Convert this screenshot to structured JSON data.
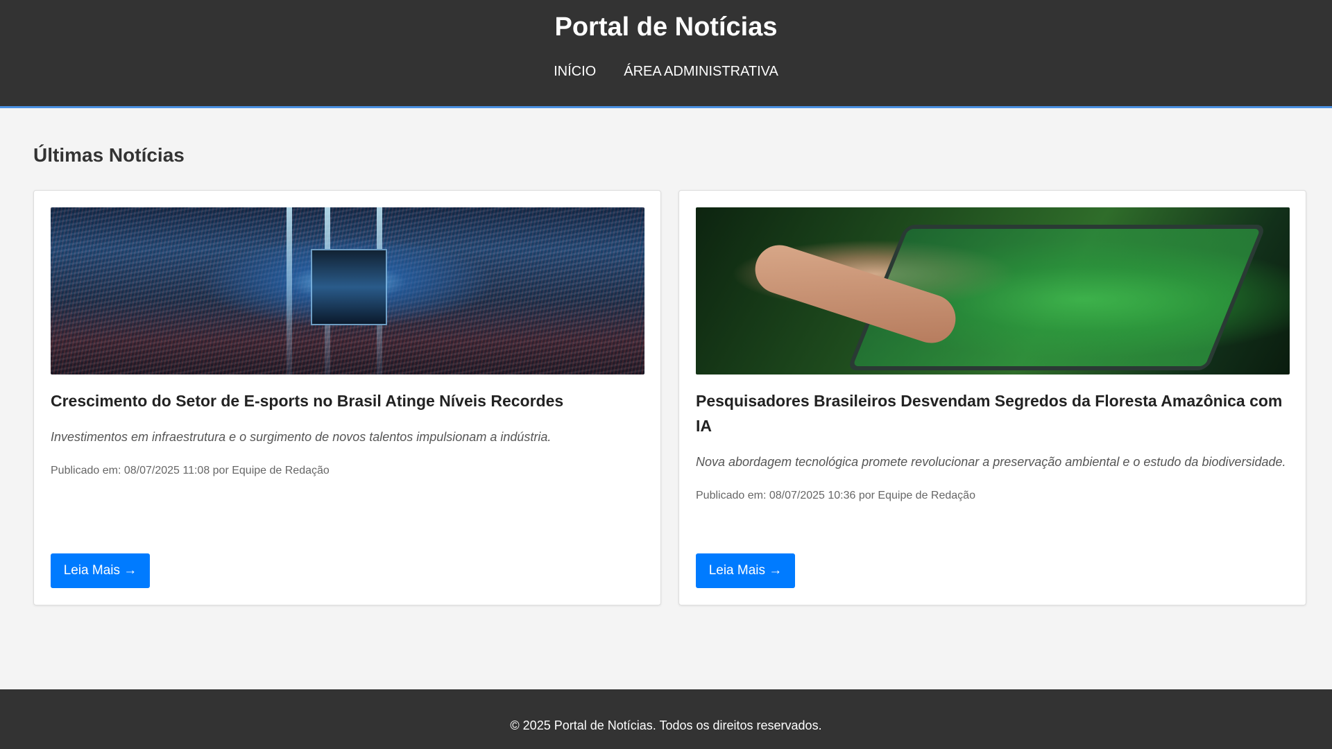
{
  "header": {
    "title": "Portal de Notícias",
    "nav": [
      {
        "label": "INÍCIO"
      },
      {
        "label": "ÁREA ADMINISTRATIVA"
      }
    ]
  },
  "main": {
    "section_title": "Últimas Notícias",
    "articles": [
      {
        "title": "Crescimento do Setor de E-sports no Brasil Atinge Níveis Recordes",
        "summary": "Investimentos em infraestrutura e o surgimento de novos talentos impulsionam a indústria.",
        "meta": "Publicado em: 08/07/2025 11:08 por Equipe de Redação",
        "button_label": "Leia Mais →"
      },
      {
        "title": "Pesquisadores Brasileiros Desvendam Segredos da Floresta Amazônica com IA",
        "summary": "Nova abordagem tecnológica promete revolucionar a preservação ambiental e o estudo da biodiversidade.",
        "meta": "Publicado em: 08/07/2025 10:36 por Equipe de Redação",
        "button_label": "Leia Mais →"
      }
    ]
  },
  "footer": {
    "text": "© 2025 Portal de Notícias. Todos os direitos reservados."
  },
  "colors": {
    "header_bg": "#333333",
    "accent_line": "#4a90e2",
    "button_bg": "#007bff",
    "page_bg": "#f4f4f4"
  }
}
